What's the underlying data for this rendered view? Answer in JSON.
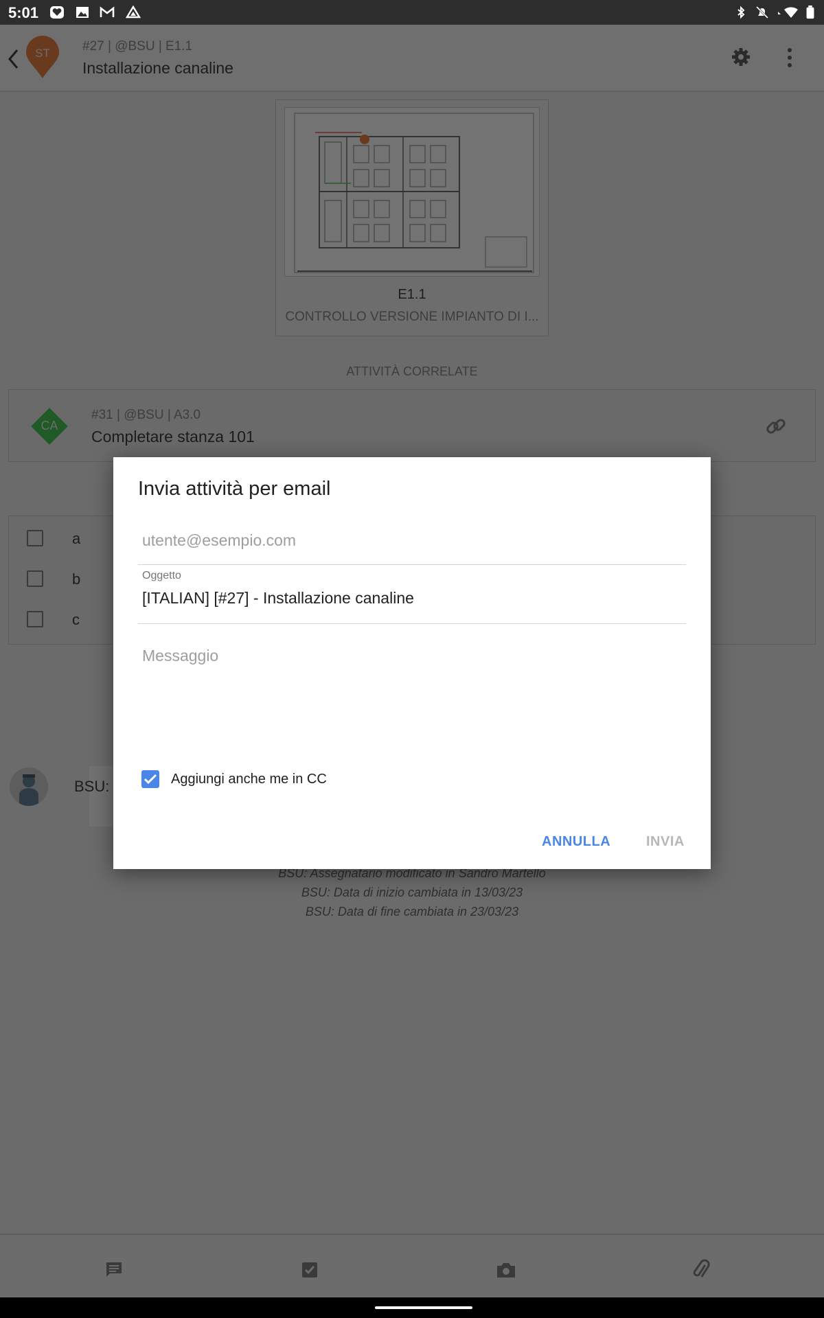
{
  "status_bar": {
    "time": "5:01",
    "left_icons": [
      "heart-shield-icon",
      "image-icon",
      "gmail-icon",
      "drive-icon"
    ],
    "right_icons": [
      "bluetooth-icon",
      "mute-icon",
      "wifi-icon",
      "battery-icon"
    ]
  },
  "header": {
    "avatar_initials": "ST",
    "subtitle": "#27 | @BSU | E1.1",
    "title": "Installazione canaline"
  },
  "drawing": {
    "code": "E1.1",
    "name": "CONTROLLO VERSIONE IMPIANTO DI I..."
  },
  "related": {
    "section_label": "ATTIVITÀ CORRELATE",
    "items": [
      {
        "badge": "CA",
        "subtitle": "#31 | @BSU | A3.0",
        "title": "Completare stanza 101"
      }
    ]
  },
  "checklist": [
    {
      "label": "a"
    },
    {
      "label": "b"
    },
    {
      "label": "c"
    }
  ],
  "comment": {
    "author_prefix": "BSU:"
  },
  "history": [
    "BSU: Assegnatario modificato in Sandro Martello",
    "BSU: Data di inizio cambiata in 13/03/23",
    "BSU: Data di fine cambiata in 23/03/23"
  ],
  "bottom_nav": [
    "comment-icon",
    "checkbox-icon",
    "camera-icon",
    "attachment-icon"
  ],
  "dialog": {
    "title": "Invia attività per email",
    "email_placeholder": "utente@esempio.com",
    "subject_label": "Oggetto",
    "subject_value": "[ITALIAN] [#27] - Installazione canaline",
    "message_placeholder": "Messaggio",
    "cc_label": "Aggiungi anche me in CC",
    "cc_checked": true,
    "cancel_label": "ANNULLA",
    "send_label": "INVIA"
  },
  "colors": {
    "accent": "#4a86e8",
    "avatar_st": "#b6551b",
    "badge_ca": "#2e8b3a",
    "scrim": "#6b6b6c"
  }
}
